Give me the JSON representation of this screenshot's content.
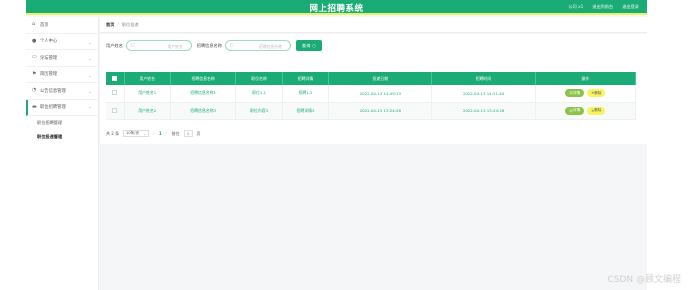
{
  "header": {
    "title": "网上招聘系统",
    "links": [
      "公司 x1",
      "退出到前台",
      "退出登录"
    ]
  },
  "sidebar": {
    "items": [
      {
        "label": "首页",
        "icon": "home-icon",
        "chevron": false
      },
      {
        "label": "个人中心",
        "icon": "user-icon",
        "chevron": true
      },
      {
        "label": "论坛管理",
        "icon": "forum-icon",
        "chevron": true
      },
      {
        "label": "简历管理",
        "icon": "flag-icon",
        "chevron": true
      },
      {
        "label": "公告信息管理",
        "icon": "notice-icon",
        "chevron": true
      },
      {
        "label": "职位招聘管理",
        "icon": "folder-icon",
        "chevron": true
      }
    ],
    "submenu": [
      "职位招聘管理",
      "职位投递管理"
    ]
  },
  "breadcrumb": {
    "home": "首页",
    "separator": "/",
    "current": "职位投递"
  },
  "search": {
    "fields": [
      {
        "label": "用户姓名",
        "placeholder": "用户姓名"
      },
      {
        "label": "招聘信息名称",
        "placeholder": "招聘信息名称"
      }
    ],
    "button_label": "查询",
    "button_icon": "search-icon"
  },
  "table": {
    "columns": [
      "",
      "用户姓名",
      "招聘信息名称",
      "职位名称",
      "招聘详情",
      "投递日期",
      "招聘时间",
      "操作"
    ],
    "rows": [
      [
        "",
        "用户姓名1",
        "招聘信息名称1",
        "职位1.1",
        "招聘1.2",
        "2022-04-13 14:49:13",
        "2022-04-13 14:51:40",
        ""
      ],
      [
        "",
        "用户姓名2",
        "招聘信息名称3",
        "职位内容3",
        "招聘详情3",
        "2022-04-13 13:24:28",
        "2022-04-13 13:24:28",
        ""
      ]
    ],
    "actions": {
      "detail": "详情",
      "delete": "删除"
    }
  },
  "pagination": {
    "total": "共 2 条",
    "page_size": "10条/页",
    "current_page": "1",
    "goto_label": "前往",
    "goto_value": "1",
    "page_unit": "页"
  },
  "watermark": "CSDN @顾文编程",
  "colors": {
    "primary": "#1aab76",
    "accent_stripe": "#e9f36a",
    "detail_btn": "#8bc34a",
    "delete_btn": "#f6f560"
  }
}
